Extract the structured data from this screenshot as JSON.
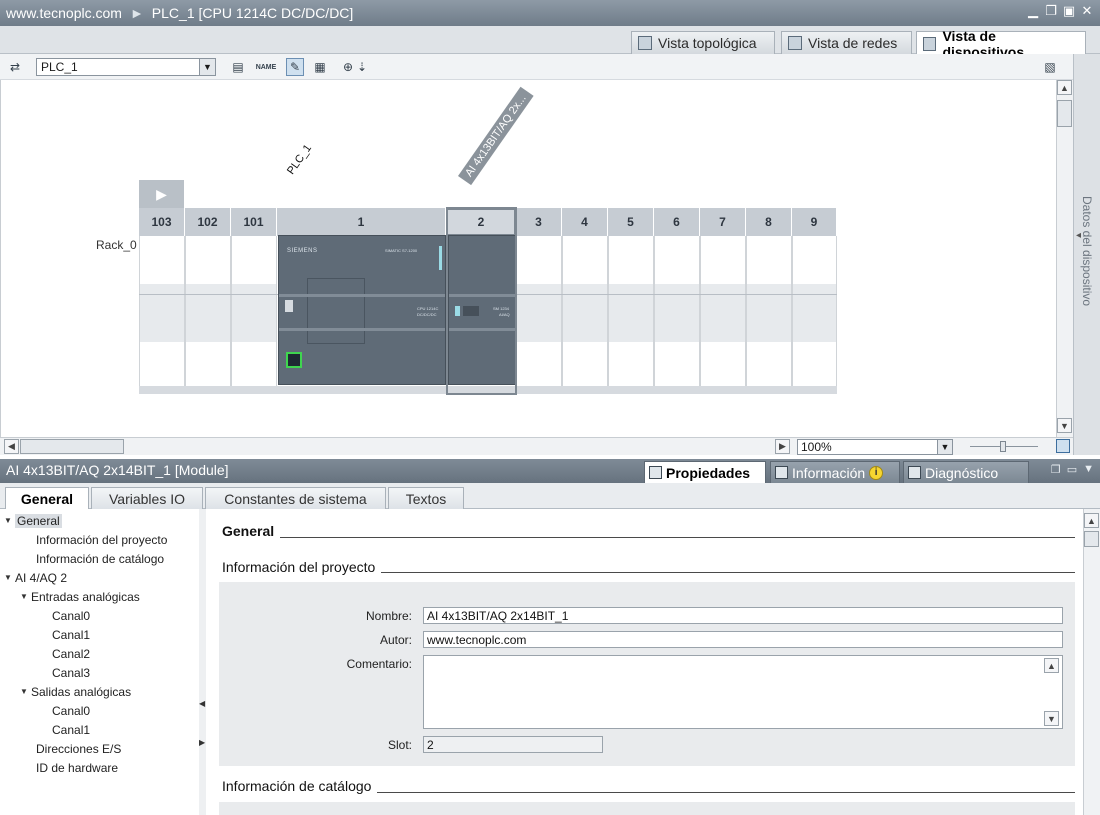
{
  "titlebar": {
    "site": "www.tecnoplc.com",
    "sep": "►",
    "device": "PLC_1 [CPU 1214C DC/DC/DC]"
  },
  "view_tabs": [
    {
      "label": "Vista topológica",
      "icon": "topology-icon"
    },
    {
      "label": "Vista de redes",
      "icon": "network-icon"
    },
    {
      "label": "Vista de dispositivos",
      "icon": "device-icon"
    }
  ],
  "toolbar": {
    "device_select": "PLC_1",
    "name_btn": "NAME"
  },
  "rack": {
    "name": "Rack_0",
    "plc_label": "PLC_1",
    "module_label": "AI 4x13BIT/AQ 2x...",
    "slots": [
      "103",
      "102",
      "101",
      "1",
      "2",
      "3",
      "4",
      "5",
      "6",
      "7",
      "8",
      "9"
    ],
    "cpu_brand": "SIEMENS",
    "cpu_model": "SIMATIC S7-1200",
    "cpu_text": "CPU 1214C",
    "cpu_text2": "DC/DC/DC",
    "sm_text": "SM 1234",
    "sm_text2": "AI/AQ"
  },
  "canvas": {
    "zoom": "100%"
  },
  "sidebar": {
    "label": "Datos del dispositivo"
  },
  "inspector": {
    "title": "AI 4x13BIT/AQ 2x14BIT_1 [Module]",
    "tabs": [
      "Propiedades",
      "Información",
      "Diagnóstico"
    ],
    "info_badge": "i",
    "subtabs": [
      "General",
      "Variables IO",
      "Constantes de sistema",
      "Textos"
    ]
  },
  "tree": [
    {
      "label": "General",
      "level": 0,
      "twisty": "▼",
      "selected": true
    },
    {
      "label": "Información del proyecto",
      "level": 1,
      "twisty": ""
    },
    {
      "label": "Información de catálogo",
      "level": 1,
      "twisty": ""
    },
    {
      "label": "AI 4/AQ 2",
      "level": 0,
      "twisty": "▼"
    },
    {
      "label": "Entradas analógicas",
      "level": 1,
      "twisty": "▼"
    },
    {
      "label": "Canal0",
      "level": 2,
      "twisty": ""
    },
    {
      "label": "Canal1",
      "level": 2,
      "twisty": ""
    },
    {
      "label": "Canal2",
      "level": 2,
      "twisty": ""
    },
    {
      "label": "Canal3",
      "level": 2,
      "twisty": ""
    },
    {
      "label": "Salidas analógicas",
      "level": 1,
      "twisty": "▼"
    },
    {
      "label": "Canal0",
      "level": 2,
      "twisty": ""
    },
    {
      "label": "Canal1",
      "level": 2,
      "twisty": ""
    },
    {
      "label": "Direcciones E/S",
      "level": 1,
      "twisty": ""
    },
    {
      "label": "ID de hardware",
      "level": 1,
      "twisty": ""
    }
  ],
  "props": {
    "general_title": "General",
    "project_info_title": "Información del proyecto",
    "catalog_info_title": "Información de catálogo",
    "name_label": "Nombre:",
    "name_value": "AI 4x13BIT/AQ 2x14BIT_1",
    "author_label": "Autor:",
    "author_value": "www.tecnoplc.com",
    "comment_label": "Comentario:",
    "comment_value": "",
    "slot_label": "Slot:",
    "slot_value": "2"
  }
}
